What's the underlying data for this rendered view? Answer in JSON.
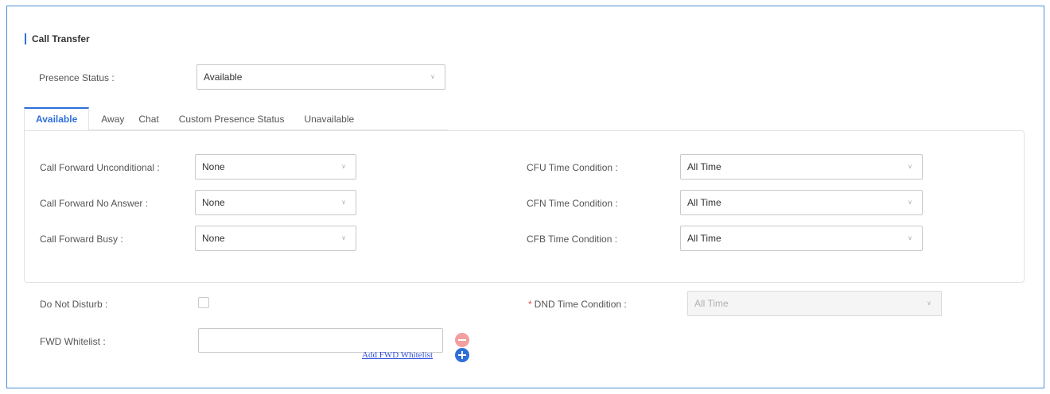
{
  "section": {
    "title": "Call Transfer"
  },
  "presence": {
    "label": "Presence Status",
    "value": "Available"
  },
  "separator": ":",
  "tabs": [
    "Available",
    "Away",
    "Chat",
    "Custom Presence Status",
    "Unavailable"
  ],
  "forward": {
    "unconditional": {
      "label": "Call Forward Unconditional",
      "value": "None"
    },
    "no_answer": {
      "label": "Call Forward No Answer",
      "value": "None"
    },
    "busy": {
      "label": "Call Forward Busy",
      "value": "None"
    }
  },
  "conditions": {
    "cfu": {
      "label": "CFU Time Condition",
      "value": "All Time"
    },
    "cfn": {
      "label": "CFN Time Condition",
      "value": "All Time"
    },
    "cfb": {
      "label": "CFB Time Condition",
      "value": "All Time"
    }
  },
  "dnd": {
    "label": "Do Not Disturb",
    "checked": false
  },
  "dnd_time": {
    "required_mark": "*",
    "label": "DND Time Condition",
    "value": "All Time"
  },
  "whitelist": {
    "label": "FWD Whitelist",
    "value": "",
    "add_label": "Add FWD Whitelist"
  },
  "icons": {
    "dropdown": "chevron-down-icon",
    "remove": "minus-circle-icon",
    "add": "plus-circle-icon"
  },
  "colors": {
    "accent": "#2e6fd8",
    "frame": "#4a90d9",
    "remove": "#f29f9f",
    "required": "#e84d4d"
  }
}
